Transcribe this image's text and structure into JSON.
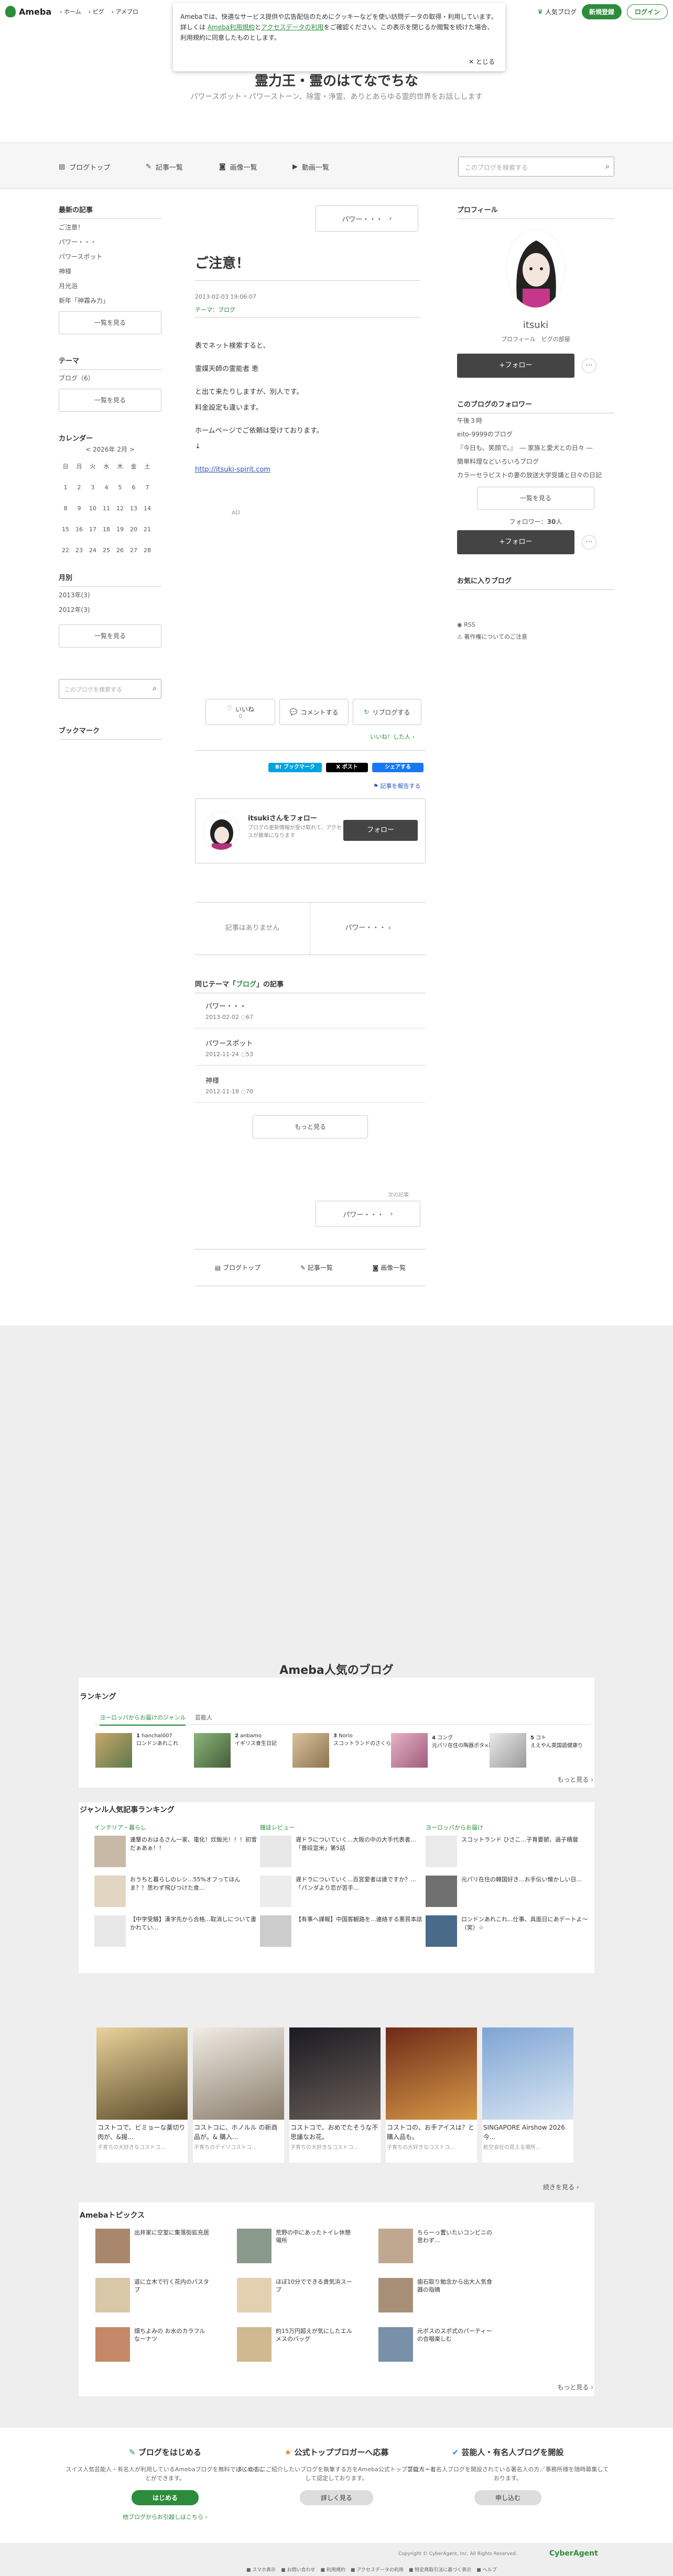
{
  "header": {
    "logo": "Ameba",
    "nav": [
      "ホーム",
      "ピグ",
      "アメブロ"
    ],
    "popular": "人気ブログ",
    "signup": "新規登録",
    "login": "ログイン"
  },
  "cookie": {
    "text1": "Amebaでは、快適なサービス提供や広告配信のためにクッキーなどを使い訪問データの取得・利用しています。詳しくは",
    "link1": "Ameba利用規約",
    "text2": "と",
    "link2": "アクセスデータの利用",
    "text3": "をご確認ください。この表示を閉じるか閲覧を続けた場合、利用規約に同意したものとします。",
    "close": "とじる"
  },
  "blog": {
    "title": "霊力王・霊のはてなでちな",
    "description": "パワースポット・パワーストーン、除霊・浄霊、ありとあらゆる霊的世界をお話しします",
    "nav": [
      "ブログトップ",
      "記事一覧",
      "画像一覧",
      "動画一覧"
    ],
    "search_placeholder": "このブログを検索する"
  },
  "left": {
    "latest_title": "最新の記事",
    "latest": [
      "ご注意！",
      "パワー・・・",
      "パワースポット",
      "神様",
      "月光浴",
      "新年「神霧み力」"
    ],
    "list_btn": "一覧を見る",
    "theme_title": "テーマ",
    "themes": [
      "ブログ（6）"
    ],
    "calendar_title": "カレンダー",
    "month": "2026年 2月",
    "prev": "<",
    "next": ">",
    "weekdays": [
      "日",
      "月",
      "火",
      "水",
      "木",
      "金",
      "土"
    ],
    "weeks": [
      [
        "1",
        "2",
        "3",
        "4",
        "5",
        "6",
        "7"
      ],
      [
        "8",
        "9",
        "10",
        "11",
        "12",
        "13",
        "14"
      ],
      [
        "15",
        "16",
        "17",
        "18",
        "19",
        "20",
        "21"
      ],
      [
        "22",
        "23",
        "24",
        "25",
        "26",
        "27",
        "28"
      ]
    ],
    "monthly_title": "月別",
    "months": [
      "2013年(3)",
      "2012年(3)"
    ],
    "search_placeholder": "このブログを検索する",
    "bookmark_title": "ブックマーク"
  },
  "article": {
    "prev_label": "パワー・・・",
    "title": "ご注意！",
    "date": "2013-02-03 19:06:07",
    "theme": "テーマ：ブログ",
    "body": [
      "表でネット検索すると、",
      "霊媒天師の霊能者 恵",
      "と出て来たりしますが、別人です。",
      "料金設定も違います。",
      "ホームページでご依頼は受けております。",
      "↓"
    ],
    "link": "http://itsuki-spirit.com",
    "ad": "AD",
    "like": "いいね",
    "like_count": "0",
    "comment": "コメントする",
    "reblog": "リブログする",
    "like_users": "いいね！した人",
    "share_hatena": "B! ブックマーク",
    "share_x": "X ポスト",
    "share_fb": "シェアする",
    "report": "記事を報告する",
    "follow_name": "itsukiさんをフォロー",
    "follow_desc": "ブログの更新情報が受け取れて、アクセスが簡単になります",
    "follow_btn": "フォロー",
    "pager_prev": "記事はありません",
    "pager_next": "パワー・・・",
    "same_theme_prefix": "同じテーマ「",
    "same_theme_name": "ブログ",
    "same_theme_suffix": "」の記事",
    "same_items": [
      {
        "title": "パワー・・・",
        "date": "2013-02-02",
        "comments": "67"
      },
      {
        "title": "パワースポット",
        "date": "2012-11-24",
        "comments": "53"
      },
      {
        "title": "神様",
        "date": "2012-11-18",
        "comments": "70"
      }
    ],
    "more": "もっと見る",
    "next_label": "次の記事",
    "bottom_nav": [
      "ブログトップ",
      "記事一覧",
      "画像一覧"
    ]
  },
  "right": {
    "profile_title": "プロフィール",
    "username": "itsuki",
    "profile_links": "プロフィール　ピグの部屋",
    "follow": "+フォロー",
    "following_title": "このブログのフォロワー",
    "following_lines": [
      "午後３時",
      "eito-9999のブログ",
      "『今日も、笑顔で。』　― 家族と愛犬との日々 ―",
      "簡単料理などいろいろブログ",
      "カラーセラピストの妻の放送大学受講と日々の日記"
    ],
    "list_btn": "一覧を見る",
    "followers": "フォロワー：",
    "followers_count": "30",
    "followers_unit": "人",
    "favorites_title": "お気に入りブログ",
    "rss": "RSS",
    "violation": "著作権についてのご注意"
  },
  "footer": {
    "popular_title": "Ameba人気のブログ",
    "ranking_title": "ランキング",
    "ranking_tabs": [
      "ヨーロッパからお届けのジャンル",
      "芸能人"
    ],
    "ranking_items": [
      {
        "rank": "1",
        "name": "hanchal007",
        "desc": "ロンドンあれこれ"
      },
      {
        "rank": "2",
        "name": "anbamo",
        "desc": "イギリス食生日記"
      },
      {
        "rank": "3",
        "name": "Norio",
        "desc": "スコットランドのさくら日記"
      },
      {
        "rank": "4",
        "name": "コング",
        "desc": "元パリ在住の陶器ポタ×路線を&..."
      },
      {
        "rank": "5",
        "name": "コト",
        "desc": "ええやん英国語健康り"
      }
    ],
    "more": "もっと見る",
    "genre_title": "ジャンル人気記事ランキング",
    "genres": [
      {
        "name": "インテリア・暮らし",
        "items": [
          "連撃のおはるさん一家、電化！炊飯光！！！初雪だぁあぁ！！",
          "おうちと暮らしのレシ...55%オフってほんま？！思わず飛びつけた食...",
          "【中学受験】漢字先から合格...取消しについて書かれてい..."
        ]
      },
      {
        "name": "雑誌レビュー",
        "items": [
          "遅ドラについていく...大阪の中の大手代表者...「普段宣米」第5話",
          "遅ドラについていく...百宮愛者は誰ですか？...「パンダより恋が苦手...",
          "【有事へ課報】中国客観路を...連絡する悪質本誌"
        ]
      },
      {
        "name": "ヨーロッパからお届け",
        "items": [
          "スコットランド ひさこ...子育要節、過子積層",
          "元パリ在住の韓国好き...お手伝い懐かしい日...",
          "ロンドンあれこれ...仕事、具面日にあデートよ～（笑）☆"
        ]
      }
    ],
    "photo_cards": [
      {
        "rank": "1",
        "title": "コストコで、ビミョーな薬切り肉が、&揚...",
        "source": "子育ちの大好きなコストコ..."
      },
      {
        "rank": "2",
        "title": "コストコに、ホノルル の新商品が。& 購入...",
        "source": "子育ちのデイリコストコ..."
      },
      {
        "rank": "3",
        "title": "コストコで、おめでたそうな不思議なお花。",
        "source": "子育ちの大好きなコストコ..."
      },
      {
        "rank": "4",
        "title": "コストコの、お手アイスは？と購入品も。",
        "source": "子育ちの大好きなコストコ..."
      },
      {
        "rank": "5",
        "title": "SINGAPORE Airshow 2026 今...",
        "source": "航空会社の見える場所..."
      }
    ],
    "photo_more": "続きを見る",
    "topics_title": "Amebaトピックス",
    "topics": [
      "出井家に空室に集落街拡充居",
      "荒野の中にあったトイレ休憩場所",
      "ちらーっ置いたいコンビニの思わず...",
      "道に立木で行く花内のパスタプ",
      "ほぼ10分でできる貴気浜スープ",
      "歯石取り勉念から出大人気食器の指摘",
      "畑ちよみの お水のカラフルなーナツ",
      "約15万円超えが気にしたエルメスのバッグ",
      "元ポスのスポ式のパーティーの合唱楽しむ"
    ],
    "topics_more": "もっと見る",
    "cta": [
      {
        "title": "ブログをはじめる",
        "text": "スイス人気芸能人・有名人が利用しているAmebaブログを無料ではじめることができます。",
        "btn": "はじめる",
        "sub": "他ブログからお引越しはこちら"
      },
      {
        "title": "公式トップブロガーへ応募",
        "text": "多くの方にご紹介したいブログを執筆する方をAmeba公式トップブロガーとして認定しております。",
        "btn": "詳しく見る"
      },
      {
        "title": "芸能人・有名人ブログを開設",
        "text": "芸能人・有名人ブログを開設されている著名人の方／事務所様を随時募集しております。",
        "btn": "申し込む"
      }
    ],
    "copyright": "Copyright © CyberAgent, Inc. All Rights Reserved.",
    "brand": "CyberAgent",
    "links": [
      "スマホ表示",
      "お問い合わせ",
      "利用規約",
      "アクセスデータの利用",
      "特定商取引法に基づく表示",
      "ヘルプ"
    ]
  },
  "colors": {
    "accent": "#2d8c3c",
    "dark": "#444444",
    "bg_gray": "#eeeeee"
  }
}
